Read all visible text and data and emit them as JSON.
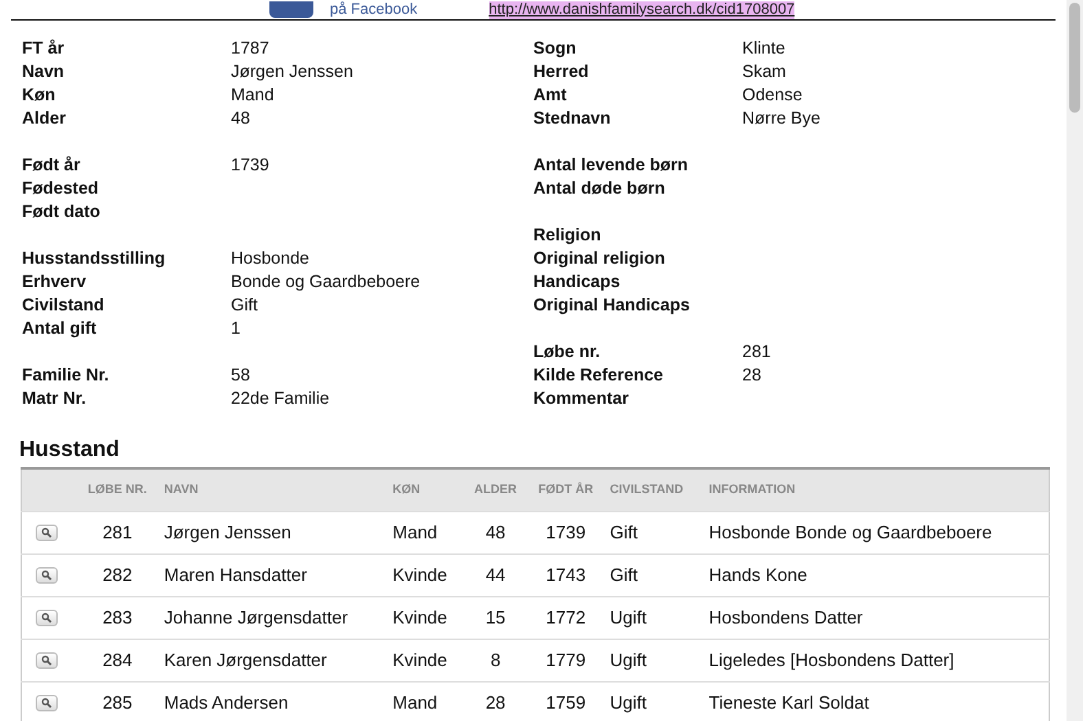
{
  "top_strip": {
    "facebook_label": "på Facebook",
    "link": "http://www.danishfamilysearch.dk/cid1708007"
  },
  "fields": {
    "left_groups": [
      [
        {
          "label": "FT år",
          "value": "1787"
        },
        {
          "label": "Navn",
          "value": "Jørgen Jenssen"
        },
        {
          "label": "Køn",
          "value": "Mand"
        },
        {
          "label": "Alder",
          "value": "48"
        }
      ],
      [
        {
          "label": "Født år",
          "value": "1739"
        },
        {
          "label": "Fødested"
        },
        {
          "label": "Født dato"
        }
      ],
      [
        {
          "label": "Husstandsstilling",
          "value": "Hosbonde"
        },
        {
          "label": "Erhverv",
          "value": "Bonde og Gaardbeboere"
        },
        {
          "label": "Civilstand",
          "value": "Gift"
        },
        {
          "label": "Antal gift",
          "value": "1"
        }
      ],
      [
        {
          "label": "Familie Nr.",
          "value": "58"
        },
        {
          "label": "Matr Nr.",
          "value": "22de Familie"
        }
      ]
    ],
    "right_groups": [
      [
        {
          "label": "Sogn",
          "value": "Klinte"
        },
        {
          "label": "Herred",
          "value": "Skam"
        },
        {
          "label": "Amt",
          "value": "Odense"
        },
        {
          "label": "Stednavn",
          "value": "Nørre Bye"
        }
      ],
      [
        {
          "label": "Antal levende børn"
        },
        {
          "label": "Antal døde børn"
        }
      ],
      [
        {
          "label": "Religion"
        },
        {
          "label": "Original religion"
        },
        {
          "label": "Handicaps"
        },
        {
          "label": "Original Handicaps"
        }
      ],
      [
        {
          "label": "Løbe nr.",
          "value": "281"
        },
        {
          "label": "Kilde Reference",
          "value": "28"
        },
        {
          "label": "Kommentar"
        }
      ]
    ]
  },
  "household": {
    "title": "Husstand",
    "columns": [
      "LØBE NR.",
      "NAVN",
      "KØN",
      "ALDER",
      "FØDT ÅR",
      "CIVILSTAND",
      "INFORMATION"
    ],
    "rows": [
      [
        "281",
        "Jørgen Jenssen",
        "Mand",
        "48",
        "1739",
        "Gift",
        "Hosbonde Bonde og Gaardbeboere"
      ],
      [
        "282",
        "Maren Hansdatter",
        "Kvinde",
        "44",
        "1743",
        "Gift",
        "Hands Kone"
      ],
      [
        "283",
        "Johanne Jørgensdatter",
        "Kvinde",
        "15",
        "1772",
        "Ugift",
        "Hosbondens Datter"
      ],
      [
        "284",
        "Karen Jørgensdatter",
        "Kvinde",
        "8",
        "1779",
        "Ugift",
        "Ligeledes [Hosbondens Datter]"
      ],
      [
        "285",
        "Mads Andersen",
        "Mand",
        "28",
        "1759",
        "Ugift",
        "Tieneste Karl Soldat"
      ]
    ]
  }
}
